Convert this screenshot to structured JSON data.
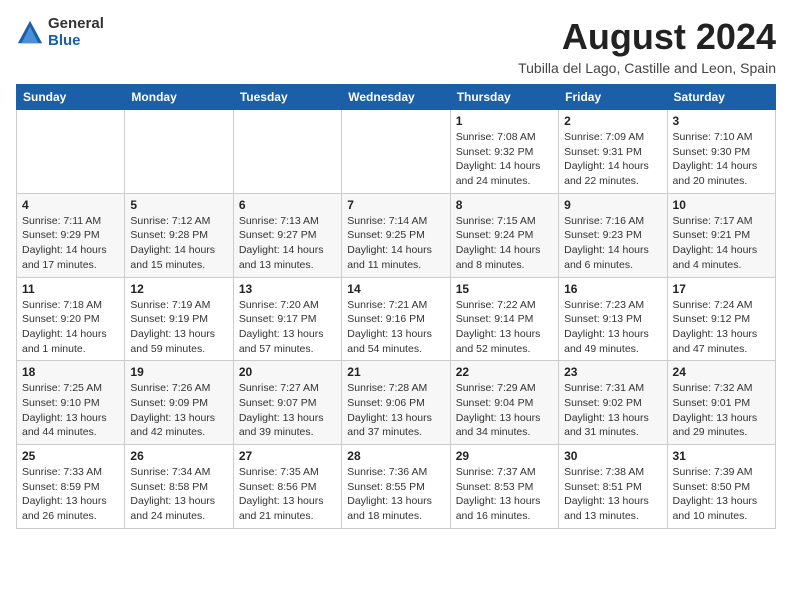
{
  "logo": {
    "general": "General",
    "blue": "Blue"
  },
  "header": {
    "month_year": "August 2024",
    "location": "Tubilla del Lago, Castille and Leon, Spain"
  },
  "weekdays": [
    "Sunday",
    "Monday",
    "Tuesday",
    "Wednesday",
    "Thursday",
    "Friday",
    "Saturday"
  ],
  "weeks": [
    [
      {
        "day": "",
        "info": ""
      },
      {
        "day": "",
        "info": ""
      },
      {
        "day": "",
        "info": ""
      },
      {
        "day": "",
        "info": ""
      },
      {
        "day": "1",
        "info": "Sunrise: 7:08 AM\nSunset: 9:32 PM\nDaylight: 14 hours and 24 minutes."
      },
      {
        "day": "2",
        "info": "Sunrise: 7:09 AM\nSunset: 9:31 PM\nDaylight: 14 hours and 22 minutes."
      },
      {
        "day": "3",
        "info": "Sunrise: 7:10 AM\nSunset: 9:30 PM\nDaylight: 14 hours and 20 minutes."
      }
    ],
    [
      {
        "day": "4",
        "info": "Sunrise: 7:11 AM\nSunset: 9:29 PM\nDaylight: 14 hours and 17 minutes."
      },
      {
        "day": "5",
        "info": "Sunrise: 7:12 AM\nSunset: 9:28 PM\nDaylight: 14 hours and 15 minutes."
      },
      {
        "day": "6",
        "info": "Sunrise: 7:13 AM\nSunset: 9:27 PM\nDaylight: 14 hours and 13 minutes."
      },
      {
        "day": "7",
        "info": "Sunrise: 7:14 AM\nSunset: 9:25 PM\nDaylight: 14 hours and 11 minutes."
      },
      {
        "day": "8",
        "info": "Sunrise: 7:15 AM\nSunset: 9:24 PM\nDaylight: 14 hours and 8 minutes."
      },
      {
        "day": "9",
        "info": "Sunrise: 7:16 AM\nSunset: 9:23 PM\nDaylight: 14 hours and 6 minutes."
      },
      {
        "day": "10",
        "info": "Sunrise: 7:17 AM\nSunset: 9:21 PM\nDaylight: 14 hours and 4 minutes."
      }
    ],
    [
      {
        "day": "11",
        "info": "Sunrise: 7:18 AM\nSunset: 9:20 PM\nDaylight: 14 hours and 1 minute."
      },
      {
        "day": "12",
        "info": "Sunrise: 7:19 AM\nSunset: 9:19 PM\nDaylight: 13 hours and 59 minutes."
      },
      {
        "day": "13",
        "info": "Sunrise: 7:20 AM\nSunset: 9:17 PM\nDaylight: 13 hours and 57 minutes."
      },
      {
        "day": "14",
        "info": "Sunrise: 7:21 AM\nSunset: 9:16 PM\nDaylight: 13 hours and 54 minutes."
      },
      {
        "day": "15",
        "info": "Sunrise: 7:22 AM\nSunset: 9:14 PM\nDaylight: 13 hours and 52 minutes."
      },
      {
        "day": "16",
        "info": "Sunrise: 7:23 AM\nSunset: 9:13 PM\nDaylight: 13 hours and 49 minutes."
      },
      {
        "day": "17",
        "info": "Sunrise: 7:24 AM\nSunset: 9:12 PM\nDaylight: 13 hours and 47 minutes."
      }
    ],
    [
      {
        "day": "18",
        "info": "Sunrise: 7:25 AM\nSunset: 9:10 PM\nDaylight: 13 hours and 44 minutes."
      },
      {
        "day": "19",
        "info": "Sunrise: 7:26 AM\nSunset: 9:09 PM\nDaylight: 13 hours and 42 minutes."
      },
      {
        "day": "20",
        "info": "Sunrise: 7:27 AM\nSunset: 9:07 PM\nDaylight: 13 hours and 39 minutes."
      },
      {
        "day": "21",
        "info": "Sunrise: 7:28 AM\nSunset: 9:06 PM\nDaylight: 13 hours and 37 minutes."
      },
      {
        "day": "22",
        "info": "Sunrise: 7:29 AM\nSunset: 9:04 PM\nDaylight: 13 hours and 34 minutes."
      },
      {
        "day": "23",
        "info": "Sunrise: 7:31 AM\nSunset: 9:02 PM\nDaylight: 13 hours and 31 minutes."
      },
      {
        "day": "24",
        "info": "Sunrise: 7:32 AM\nSunset: 9:01 PM\nDaylight: 13 hours and 29 minutes."
      }
    ],
    [
      {
        "day": "25",
        "info": "Sunrise: 7:33 AM\nSunset: 8:59 PM\nDaylight: 13 hours and 26 minutes."
      },
      {
        "day": "26",
        "info": "Sunrise: 7:34 AM\nSunset: 8:58 PM\nDaylight: 13 hours and 24 minutes."
      },
      {
        "day": "27",
        "info": "Sunrise: 7:35 AM\nSunset: 8:56 PM\nDaylight: 13 hours and 21 minutes."
      },
      {
        "day": "28",
        "info": "Sunrise: 7:36 AM\nSunset: 8:55 PM\nDaylight: 13 hours and 18 minutes."
      },
      {
        "day": "29",
        "info": "Sunrise: 7:37 AM\nSunset: 8:53 PM\nDaylight: 13 hours and 16 minutes."
      },
      {
        "day": "30",
        "info": "Sunrise: 7:38 AM\nSunset: 8:51 PM\nDaylight: 13 hours and 13 minutes."
      },
      {
        "day": "31",
        "info": "Sunrise: 7:39 AM\nSunset: 8:50 PM\nDaylight: 13 hours and 10 minutes."
      }
    ]
  ]
}
